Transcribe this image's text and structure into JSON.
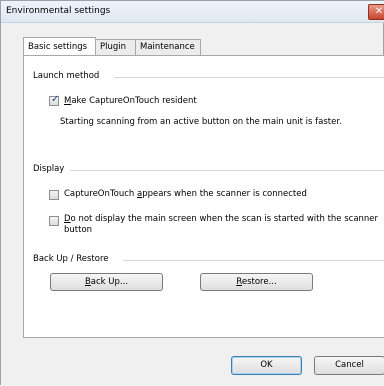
{
  "window": {
    "title": "Environmental settings",
    "close_symbol": "✕"
  },
  "tabs": [
    {
      "label": "Basic settings",
      "active": true
    },
    {
      "label": "Plugin",
      "active": false
    },
    {
      "label": "Maintenance",
      "active": false
    }
  ],
  "launch_method": {
    "heading": "Launch method",
    "resident_checkbox": {
      "access_key": "M",
      "label_rest": "ake CaptureOnTouch resident",
      "checked": true
    },
    "note": "Starting scanning from an active button on the main unit is faster."
  },
  "display": {
    "heading": "Display",
    "appears_checkbox": {
      "before": "CaptureOnTouch ",
      "access_key": "a",
      "after": "ppears when the scanner is connected",
      "checked": false
    },
    "no_main_screen_checkbox": {
      "access_key": "D",
      "line1_rest": "o not display the main screen when the scan is started with the scanner",
      "line2": "button",
      "checked": false
    }
  },
  "backup_restore": {
    "heading": "Back Up / Restore",
    "backup_button": {
      "access_key": "B",
      "label_rest": "ack Up..."
    },
    "restore_button": {
      "access_key": "R",
      "label_rest": "estore..."
    }
  },
  "footer": {
    "ok_label": "OK",
    "cancel_label": "Cancel"
  }
}
